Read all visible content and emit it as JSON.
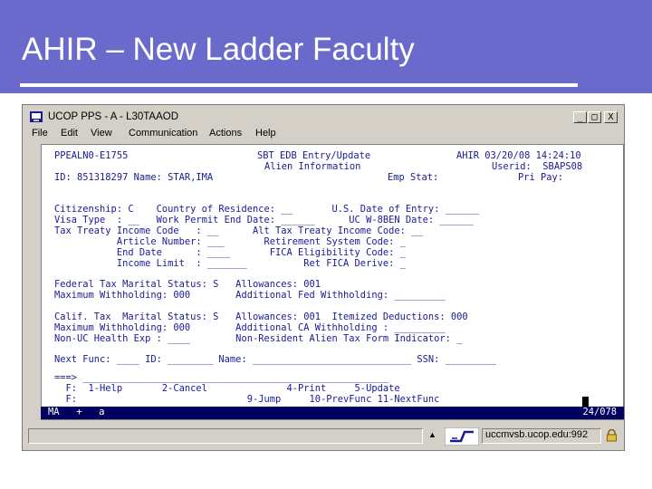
{
  "slide": {
    "title": "AHIR – New Ladder Faculty"
  },
  "window": {
    "title": "UCOP PPS - A - L30TAAOD",
    "controls": [
      "_",
      "□",
      "X"
    ]
  },
  "menu": [
    "File",
    "Edit",
    "View",
    "Communication",
    "Actions",
    "Help"
  ],
  "screen": {
    "header": {
      "left": "PPEALN0-E1755",
      "center1": "SBT EDB Entry/Update",
      "center2": "Alien Information",
      "right": "AHIR 03/20/08 14:24:10",
      "userid": "Userid:  SBAPS08",
      "paypay": "Pri Pay:",
      "id_label": "ID: 851318297 Name: STAR,IMA",
      "emp_stat": "Emp Stat:"
    },
    "fields": {
      "citizenship": "C",
      "country_of_residence": "__",
      "us_date_of_entry": "______",
      "visa_type": "__",
      "work_permit_end_date": "______",
      "uc_w8ben_date": "______",
      "tax_treaty_income_code": "__",
      "alt_tax_treaty_income_code": "__",
      "article_number": "___",
      "retirement_system_code": "_",
      "end_date": "____",
      "fica_eligibility_code": "_",
      "income_limit": "_______",
      "ret_fica_derive": "_",
      "fed_marital_status": "S",
      "fed_allowances": "001",
      "max_withholding_fed": "000",
      "addl_fed_withholding": "_________",
      "ca_marital_status": "S",
      "ca_allowances": "001",
      "itemized_deductions": "000",
      "max_withholding_ca": "000",
      "addl_ca_withholding": "_________",
      "non_uc_health_exp": "____",
      "nra_tax_form_indicator": "_"
    },
    "lines": [
      "Citizenship: C    Country of Residence: __       U.S. Date of Entry: ______",
      "Visa Type  : __   Work Permit End Date: ______      UC W-8BEN Date: ______",
      "Tax Treaty Income Code   : __      Alt Tax Treaty Income Code: __",
      "           Article Number: ___       Retirement System Code: _",
      "           End Date      : ____       FICA Eligibility Code: _",
      "           Income Limit  : _______          Ret FICA Derive: _",
      "Federal Tax Marital Status: S   Allowances: 001",
      "Maximum Withholding: 000        Additional Fed Withholding: _________",
      "Calif. Tax  Marital Status: S   Allowances: 001  Itemized Deductions: 000",
      "Maximum Withholding: 000        Additional CA Withholding : _________",
      "Non-UC Health Exp : ____        Non-Resident Alien Tax Form Indicator: _",
      "Next Func: ____ ID: ________ Name: ____________________________ SSN: _________",
      "===> ______________________________________________________",
      "  F:  1-Help       2-Cancel              4-Print     5-Update",
      "  F:                              9-Jump     10-PrevFunc 11-NextFunc"
    ],
    "status_left": "MA   +   a",
    "status_right": "24/078"
  },
  "statusbar": {
    "host": "uccmvsb.ucop.edu:992"
  },
  "icons": {
    "app": "terminal-app-icon",
    "network": "network-connection-icon",
    "secure": "secure-lock-icon"
  },
  "colors": {
    "banner": "#6a6acc",
    "terminal_text": "#1a1a96",
    "status_bg": "#000060"
  }
}
